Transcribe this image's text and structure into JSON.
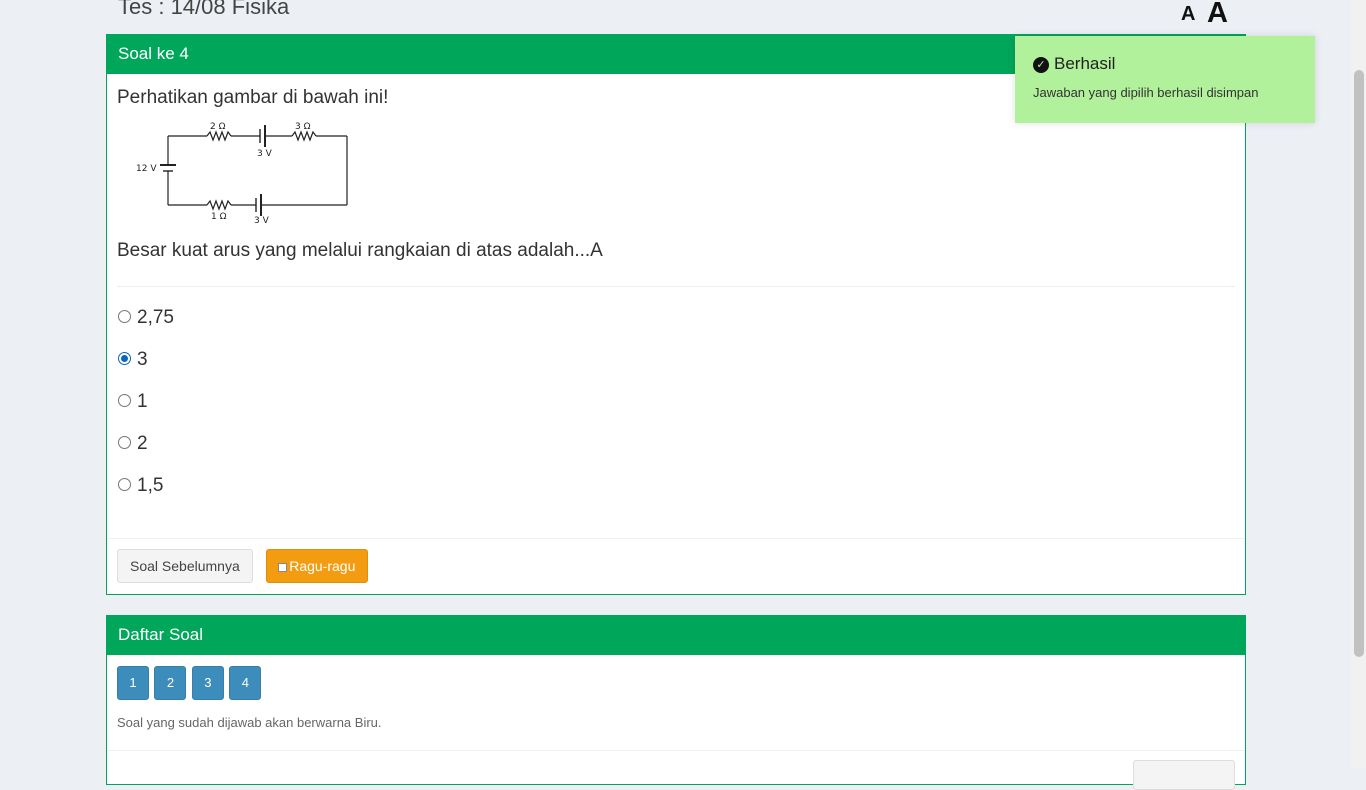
{
  "page": {
    "title": "Tes : 14/08 Fisika",
    "font_small_label": "A",
    "font_large_label": "A"
  },
  "question": {
    "header": "Soal ke 4",
    "intro": "Perhatikan gambar di bawah ini!",
    "prompt": "Besar kuat arus yang melalui rangkaian di atas adalah...A",
    "circuit_labels": {
      "r_top_left": "2 Ω",
      "r_top_right": "3 Ω",
      "v_top": "3 V",
      "v_left": "12 V",
      "r_bottom": "1 Ω",
      "v_bottom": "3 V"
    },
    "options": [
      {
        "label": "2,75",
        "selected": false
      },
      {
        "label": "3",
        "selected": true
      },
      {
        "label": "1",
        "selected": false
      },
      {
        "label": "2",
        "selected": false
      },
      {
        "label": "1,5",
        "selected": false
      }
    ],
    "prev_button": "Soal Sebelumnya",
    "doubt_button": "Ragu-ragu"
  },
  "question_list": {
    "header": "Daftar Soal",
    "numbers": [
      "1",
      "2",
      "3",
      "4"
    ],
    "note": "Soal yang sudah dijawab akan berwarna Biru."
  },
  "toast": {
    "title": "Berhasil",
    "message": "Jawaban yang dipilih berhasil disimpan"
  },
  "colors": {
    "header_green": "#00a65a",
    "answered_blue": "#3c8dbc",
    "warning_orange": "#f39c12",
    "toast_green": "#b2f19c"
  }
}
